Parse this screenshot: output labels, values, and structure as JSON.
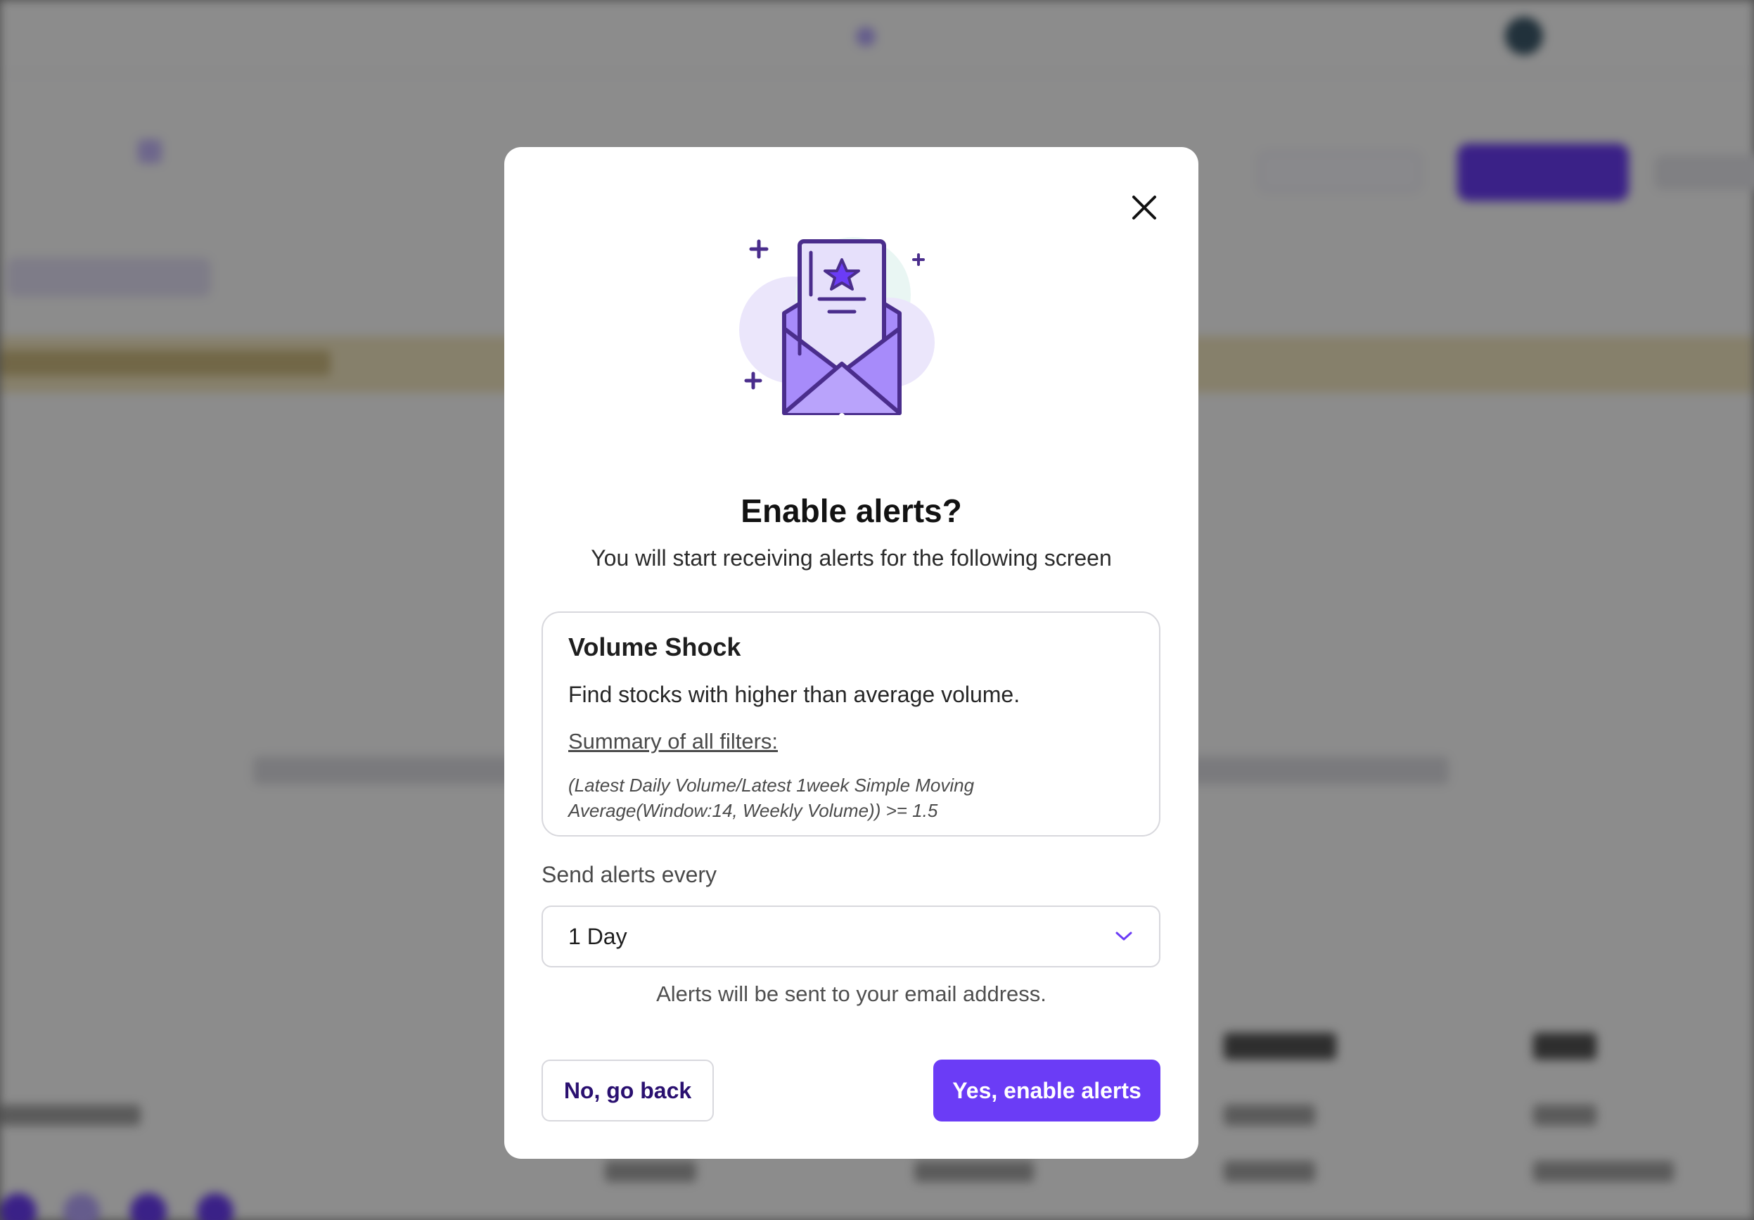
{
  "modal": {
    "title": "Enable alerts?",
    "subtitle": "You will start receiving alerts for the following screen",
    "close_icon": "close-icon",
    "illustration_icon": "envelope-star-icon",
    "screen": {
      "name": "Volume Shock",
      "description": "Find stocks with higher than average volume.",
      "filters_label": "Summary of all filters:",
      "filters_text": "(Latest Daily Volume/Latest 1week Simple Moving Average(Window:14, Weekly Volume)) >= 1.5"
    },
    "frequency": {
      "label": "Send alerts every",
      "value": "1 Day",
      "icon": "chevron-down-icon"
    },
    "email_note": "Alerts will be sent to your email address.",
    "buttons": {
      "back": "No, go back",
      "enable": "Yes, enable alerts"
    }
  },
  "colors": {
    "accent": "#6b3cf6",
    "accent_dark": "#2a1070",
    "illustration_purple": "#a78bfa",
    "illustration_light": "#e6e0fb",
    "illustration_stroke": "#4a2d8c"
  }
}
